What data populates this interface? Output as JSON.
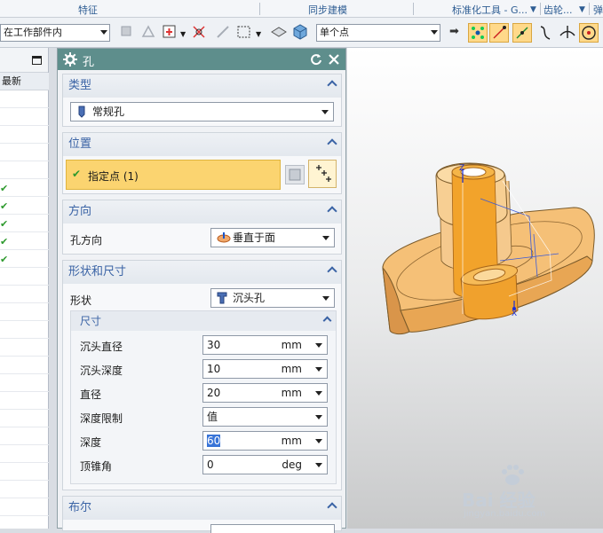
{
  "ribbon": {
    "groups": [
      "特征",
      "同步建模",
      "标准化工具 - G...",
      "齿轮...",
      "弹"
    ]
  },
  "toolbar": {
    "scope_combo": "在工作部件内",
    "snap_combo": "单个点"
  },
  "navigator": {
    "column_header": "最新",
    "check_mark": "✔",
    "checked_rows": 5
  },
  "dialog": {
    "title": "孔",
    "type_section": {
      "header": "类型",
      "value": "常规孔"
    },
    "position_section": {
      "header": "位置",
      "specify_point": "指定点 (1)"
    },
    "direction_section": {
      "header": "方向",
      "label": "孔方向",
      "value": "垂直于面"
    },
    "shape_section": {
      "header": "形状和尺寸",
      "shape_label": "形状",
      "shape_value": "沉头孔",
      "dims_header": "尺寸",
      "rows": [
        {
          "label": "沉头直径",
          "value": "30",
          "unit": "mm"
        },
        {
          "label": "沉头深度",
          "value": "10",
          "unit": "mm"
        },
        {
          "label": "直径",
          "value": "20",
          "unit": "mm"
        },
        {
          "label": "深度限制",
          "value": "值",
          "unit": ""
        },
        {
          "label": "深度",
          "value": "60",
          "unit": "mm"
        },
        {
          "label": "顶锥角",
          "value": "0",
          "unit": "deg"
        }
      ]
    },
    "boolean_section": {
      "header": "布尔"
    }
  },
  "viewport": {
    "axis_x": "X",
    "axis_z": "Z"
  },
  "watermark": {
    "brand": "Bai 经验",
    "url": "jingyan.baidu.com"
  },
  "colors": {
    "dialog_title_bar": "#5e8e8c",
    "section_header_text": "#3a63a5",
    "selected_row": "#fbd470",
    "part_orange": "#f2a32b"
  }
}
